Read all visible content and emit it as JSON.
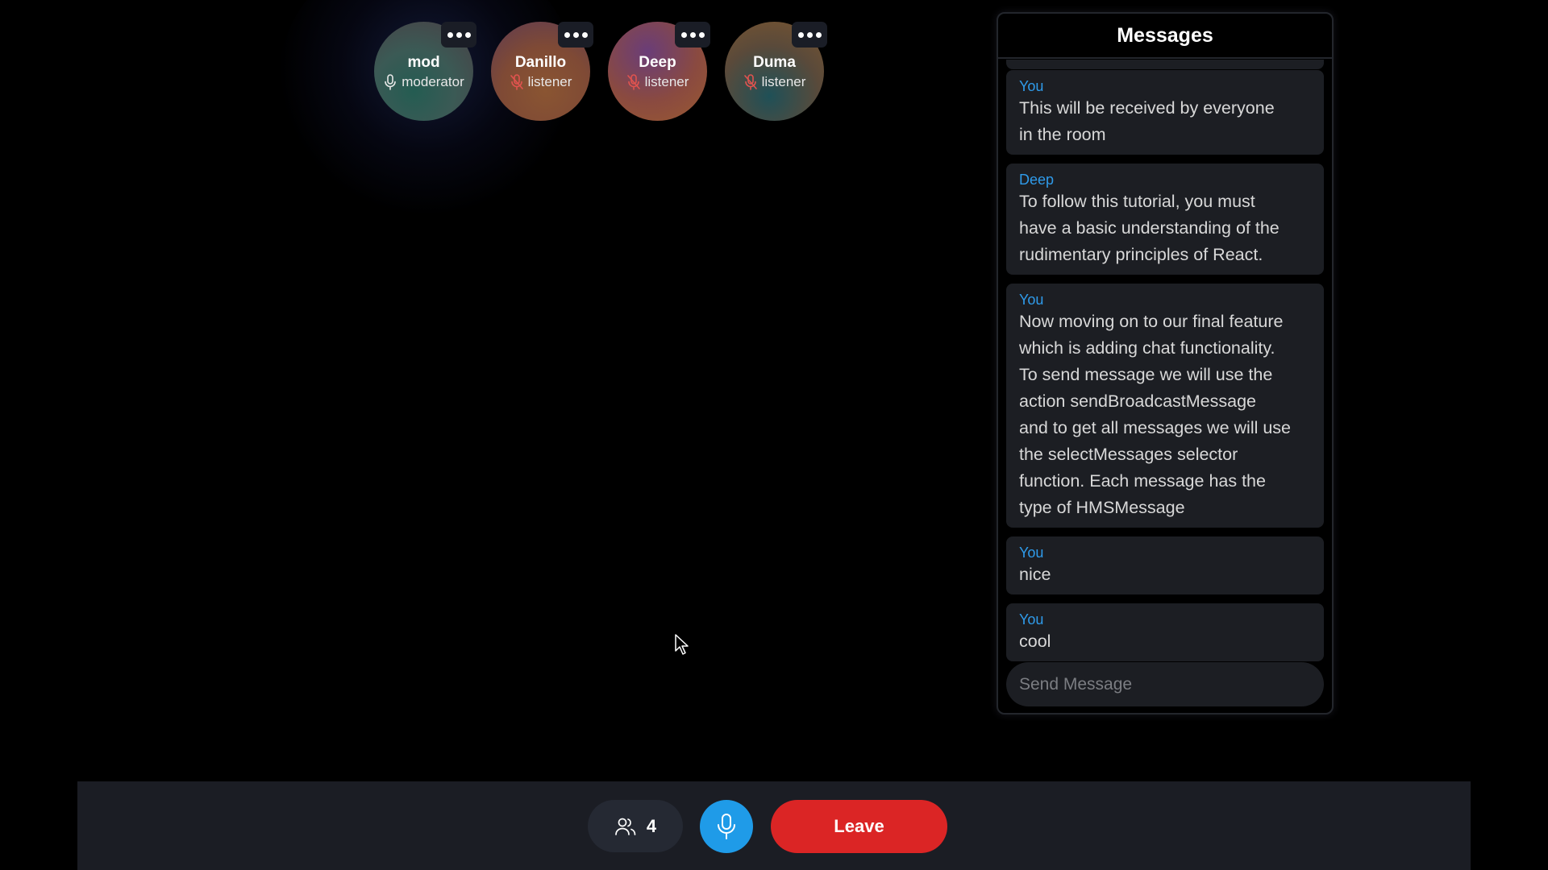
{
  "peers": [
    {
      "name": "mod",
      "role": "moderator",
      "muted": false
    },
    {
      "name": "Danillo",
      "role": "listener",
      "muted": true
    },
    {
      "name": "Deep",
      "role": "listener",
      "muted": true
    },
    {
      "name": "Duma",
      "role": "listener",
      "muted": true
    }
  ],
  "chat": {
    "title": "Messages",
    "messages": [
      {
        "sender": "You",
        "lines": [
          "This will be received by everyone",
          "in the room"
        ]
      },
      {
        "sender": "Deep",
        "lines": [
          "To follow this tutorial, you must",
          "have a basic understanding of the",
          "rudimentary principles of React."
        ]
      },
      {
        "sender": "You",
        "lines": [
          "Now moving on to our final feature",
          "which is adding chat functionality.",
          "To send message we will use the",
          "action sendBroadcastMessage",
          "and to get all messages we will use",
          "the selectMessages selector",
          "function. Each message has the",
          "type of HMSMessage"
        ]
      },
      {
        "sender": "You",
        "lines": [
          "nice"
        ]
      },
      {
        "sender": "You",
        "lines": [
          "cool"
        ]
      }
    ],
    "input_placeholder": "Send Message"
  },
  "controls": {
    "participant_count": "4",
    "leave_label": "Leave"
  },
  "colors": {
    "accent_blue": "#1f9be8",
    "leave_red": "#db2525",
    "sender_blue": "#2f9bea",
    "muted_red": "#e0534f"
  }
}
